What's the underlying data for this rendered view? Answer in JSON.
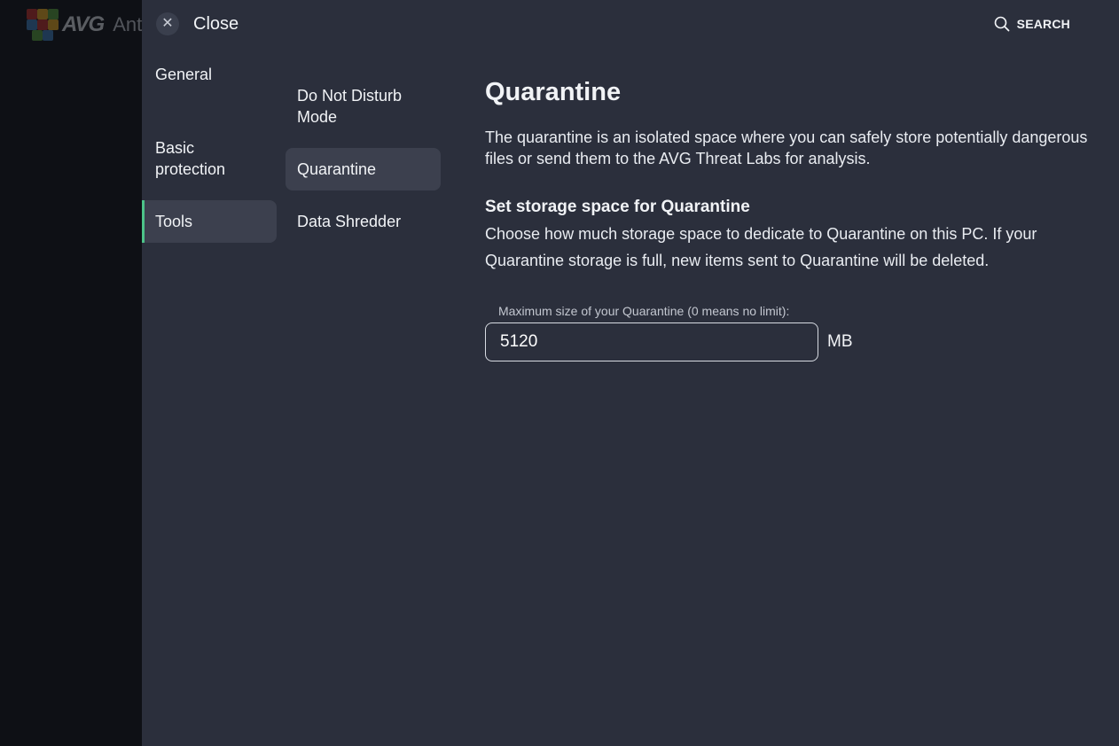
{
  "background_app": {
    "brand": "AVG",
    "product": "Ant"
  },
  "header": {
    "close_label": "Close",
    "close_glyph": "✕",
    "search_label": "SEARCH"
  },
  "nav_primary": {
    "items": [
      {
        "label": "General"
      },
      {
        "label": "Basic\nprotection"
      },
      {
        "label": "Tools"
      }
    ]
  },
  "nav_secondary": {
    "items": [
      {
        "label": "Do Not Disturb\nMode"
      },
      {
        "label": "Quarantine"
      },
      {
        "label": "Data Shredder"
      }
    ]
  },
  "content": {
    "title": "Quarantine",
    "description": "The quarantine is an isolated space where you can safely store potentially dangerous files or send them to the AVG Threat Labs for analysis.",
    "storage_heading": "Set storage space for Quarantine",
    "storage_description": "Choose how much storage space to dedicate to Quarantine on this PC. If your Quarantine storage is full, new items sent to Quarantine will be deleted.",
    "max_size_label": "Maximum size of your Quarantine (0 means no limit):",
    "max_size_value": "5120",
    "max_size_unit": "MB"
  },
  "colors": {
    "panel_bg": "#2b2f3c",
    "active_item_bg": "#3c404e",
    "accent_green": "#4cc389",
    "text_primary": "#f1f3f6"
  },
  "icons": {
    "close": "close-icon",
    "search": "search-icon",
    "logo": "avg-logo-icon"
  }
}
